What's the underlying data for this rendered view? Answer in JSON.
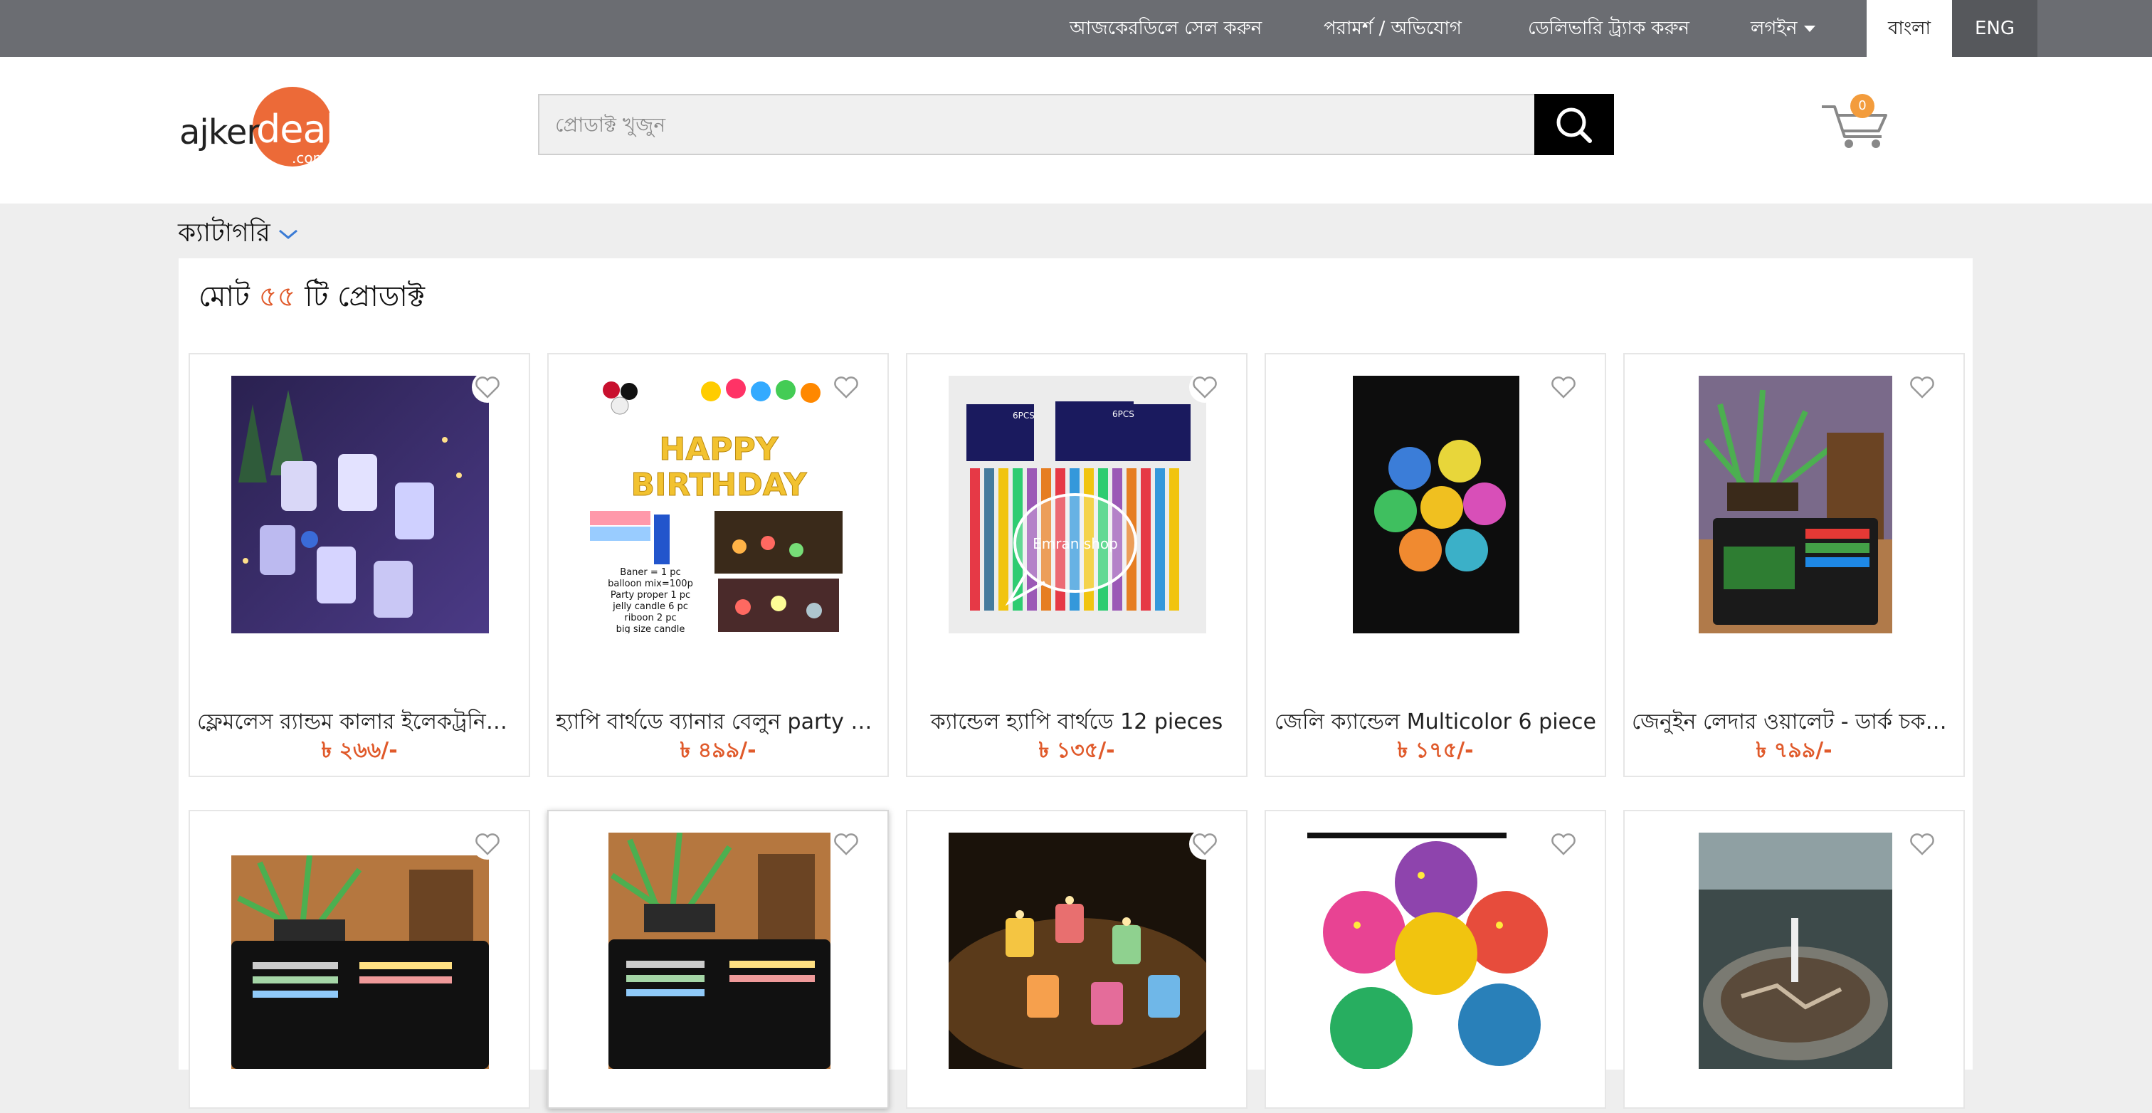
{
  "topbar": {
    "sell": "আজকেরডিলে সেল করুন",
    "complaint": "পরামর্শ / অভিযোগ",
    "track": "ডেলিভারি ট্র্যাক করুন",
    "login": "লগইন",
    "lang_bn": "বাংলা",
    "lang_en": "ENG"
  },
  "logo": {
    "ajker": "ajker",
    "deal": "deal",
    "com": ".com"
  },
  "search": {
    "placeholder": "প্রোডাক্ট খুজুন"
  },
  "cart": {
    "count": "0"
  },
  "category": {
    "label": "ক্যাটাগরি"
  },
  "summary": {
    "prefix": "মোট",
    "count": "৫৫",
    "suffix": "টি প্রোডাক্ট"
  },
  "colors": {
    "accent": "#e05a2b",
    "topbar": "#6b6d72",
    "badge": "#f39c3c"
  },
  "products": [
    {
      "name": "ফ্লেমলেস র‍্যান্ডম কালার ইলেকট্রনিক ক্যান্ডেল",
      "price": "৳ ২৬৬/-"
    },
    {
      "name": "হ্যাপি বার্থডে ব্যানার বেলুন party combo",
      "price": "৳ ৪৯৯/-"
    },
    {
      "name": "ক্যান্ডেল হ্যাপি বার্থডে 12 pieces",
      "price": "৳ ১৩৫/-",
      "overlay": "Emran shop"
    },
    {
      "name": "জেলি ক্যান্ডেল Multicolor 6 piece",
      "price": "৳ ১৭৫/-"
    },
    {
      "name": "জেনুইন লেদার ওয়ালেট - ডার্ক চকলেট",
      "price": "৳ ৭৯৯/-"
    }
  ],
  "banner_text": {
    "line1": "HAPPY",
    "line2": "BIRTHDAY",
    "notes": [
      "Baner  = 1 pc",
      "balloon mix=100p",
      "Party proper 1 pc",
      "jelly candle 6 pc",
      "riboon 2 pc",
      "big size candle"
    ],
    "pack_label": "6PCS"
  }
}
